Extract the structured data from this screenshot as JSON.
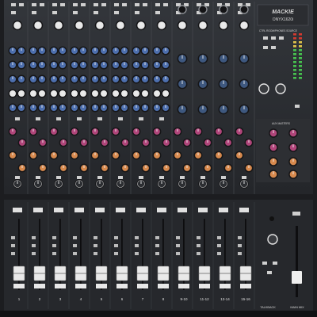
{
  "brand": {
    "name": "MACKIE",
    "model": "ONYX1620i"
  },
  "master_section": {
    "source_label": "CTRL ROOM/PHONES SOURCE",
    "aux_label": "AUX MASTERS",
    "talkback_label": "TALKBACK",
    "main_mix_label": "MAIN MIX"
  },
  "channel_numbers": [
    "1",
    "2",
    "3",
    "4",
    "5",
    "6",
    "7",
    "8",
    "9-10",
    "11-12",
    "13-14",
    "15-16"
  ],
  "colors": {
    "panel": "#2e3035",
    "mono_strip_knob": "#4d6fae",
    "stereo_knob": "#3e587f",
    "aux_knob_pink": "#b0457a",
    "aux_knob_orange": "#d88a4e",
    "fader_cap": "#e9e9e9",
    "meter_green": "#47c24f",
    "meter_red": "#d33a2f"
  }
}
